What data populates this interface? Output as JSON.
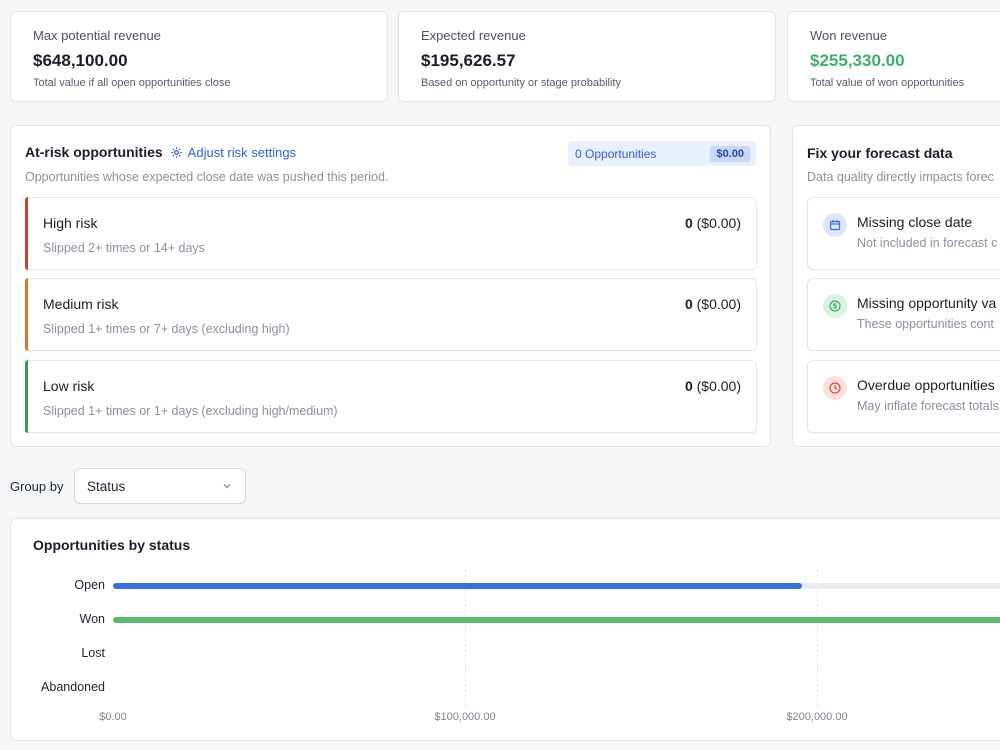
{
  "stats": [
    {
      "label": "Max potential revenue",
      "value": "$648,100.00",
      "sub": "Total value if all open opportunities close"
    },
    {
      "label": "Expected revenue",
      "value": "$195,626.57",
      "sub": "Based on opportunity or stage probability"
    },
    {
      "label": "Won revenue",
      "value": "$255,330.00",
      "sub": "Total value of won opportunities"
    }
  ],
  "at_risk": {
    "title": "At-risk opportunities",
    "adjust_link": "Adjust risk settings",
    "description": "Opportunities whose expected close date was pushed this period.",
    "pill_count": "0 Opportunities",
    "pill_amount": "$0.00",
    "rows": [
      {
        "name": "High risk",
        "desc": "Slipped 2+ times or 14+ days",
        "count": "0",
        "amount": "($0.00)",
        "color": "#c8432f"
      },
      {
        "name": "Medium risk",
        "desc": "Slipped 1+ times or 7+ days (excluding high)",
        "count": "0",
        "amount": "($0.00)",
        "color": "#d97a2b"
      },
      {
        "name": "Low risk",
        "desc": "Slipped 1+ times or 1+ days (excluding high/medium)",
        "count": "0",
        "amount": "($0.00)",
        "color": "#3c9a4c"
      }
    ]
  },
  "fix_forecast": {
    "title": "Fix your forecast data",
    "description": "Data quality directly impacts forec",
    "rows": [
      {
        "name": "Missing close date",
        "desc": "Not included in forecast c",
        "icon": "calendar-icon"
      },
      {
        "name": "Missing opportunity va",
        "desc": "These opportunities cont",
        "icon": "dollar-icon"
      },
      {
        "name": "Overdue opportunities",
        "desc": "May inflate forecast totals",
        "icon": "clock-icon"
      }
    ]
  },
  "group_by": {
    "label": "Group by",
    "selected": "Status"
  },
  "chart_data": {
    "type": "bar",
    "orientation": "horizontal",
    "title": "Opportunities by status",
    "categories": [
      "Open",
      "Won",
      "Lost",
      "Abandoned"
    ],
    "series": [
      {
        "values": [
          195626.57,
          255330.0,
          0,
          0
        ]
      }
    ],
    "tick_labels": [
      "$0.00",
      "$100,000.00",
      "$200,000.00"
    ],
    "xlim": [
      0,
      270000
    ],
    "colors": {
      "Open": "#3a6fe0",
      "Won": "#5cb870"
    },
    "track_color": "#e9ebef",
    "grid": true
  }
}
